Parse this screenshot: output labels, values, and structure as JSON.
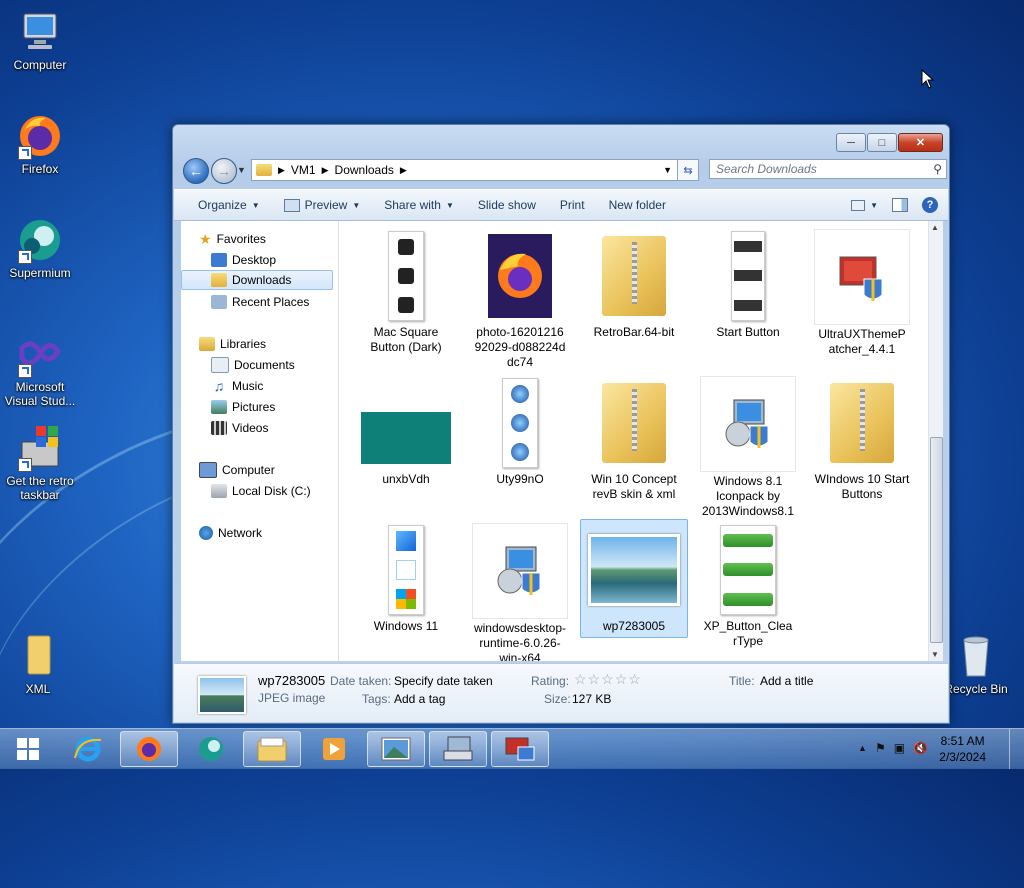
{
  "desktop": {
    "icons": [
      {
        "label": "Computer"
      },
      {
        "label": "Firefox"
      },
      {
        "label": "Supermium"
      },
      {
        "label": "Microsoft Visual Stud..."
      },
      {
        "label": "Get the retro taskbar"
      },
      {
        "label": "XML"
      },
      {
        "label": "Recycle Bin"
      }
    ]
  },
  "window": {
    "breadcrumb": [
      "VM1",
      "Downloads"
    ],
    "search_placeholder": "Search Downloads",
    "toolbar": {
      "organize": "Organize",
      "preview": "Preview",
      "share_with": "Share with",
      "slide_show": "Slide show",
      "print": "Print",
      "new_folder": "New folder"
    },
    "nav": {
      "favorites": "Favorites",
      "desktop": "Desktop",
      "downloads": "Downloads",
      "recent_places": "Recent Places",
      "libraries": "Libraries",
      "documents": "Documents",
      "music": "Music",
      "pictures": "Pictures",
      "videos": "Videos",
      "computer": "Computer",
      "local_disk": "Local Disk (C:)",
      "network": "Network"
    },
    "files": [
      {
        "name": "Mac Square Button (Dark)"
      },
      {
        "name": "photo-1620121692029-d088224ddc74"
      },
      {
        "name": "RetroBar.64-bit"
      },
      {
        "name": "Start Button"
      },
      {
        "name": "UltraUXThemePatcher_4.4.1"
      },
      {
        "name": "unxbVdh"
      },
      {
        "name": "Uty99nO"
      },
      {
        "name": "Win 10 Concept revB skin & xml"
      },
      {
        "name": "Windows 8.1 Iconpack by 2013Windows8.1"
      },
      {
        "name": "WIndows 10 Start Buttons"
      },
      {
        "name": "Windows 11"
      },
      {
        "name": "windowsdesktop-runtime-6.0.26-win-x64"
      },
      {
        "name": "wp7283005"
      },
      {
        "name": "XP_Button_ClearType"
      }
    ],
    "details": {
      "name": "wp7283005",
      "type": "JPEG image",
      "date_taken_label": "Date taken:",
      "date_taken_value": "Specify date taken",
      "tags_label": "Tags:",
      "tags_value": "Add a tag",
      "rating_label": "Rating:",
      "rating_value": 0,
      "size_label": "Size:",
      "size_value": "127 KB",
      "title_label": "Title:",
      "title_value": "Add a title"
    }
  },
  "taskbar": {
    "time": "8:51 AM",
    "date": "2/3/2024"
  }
}
